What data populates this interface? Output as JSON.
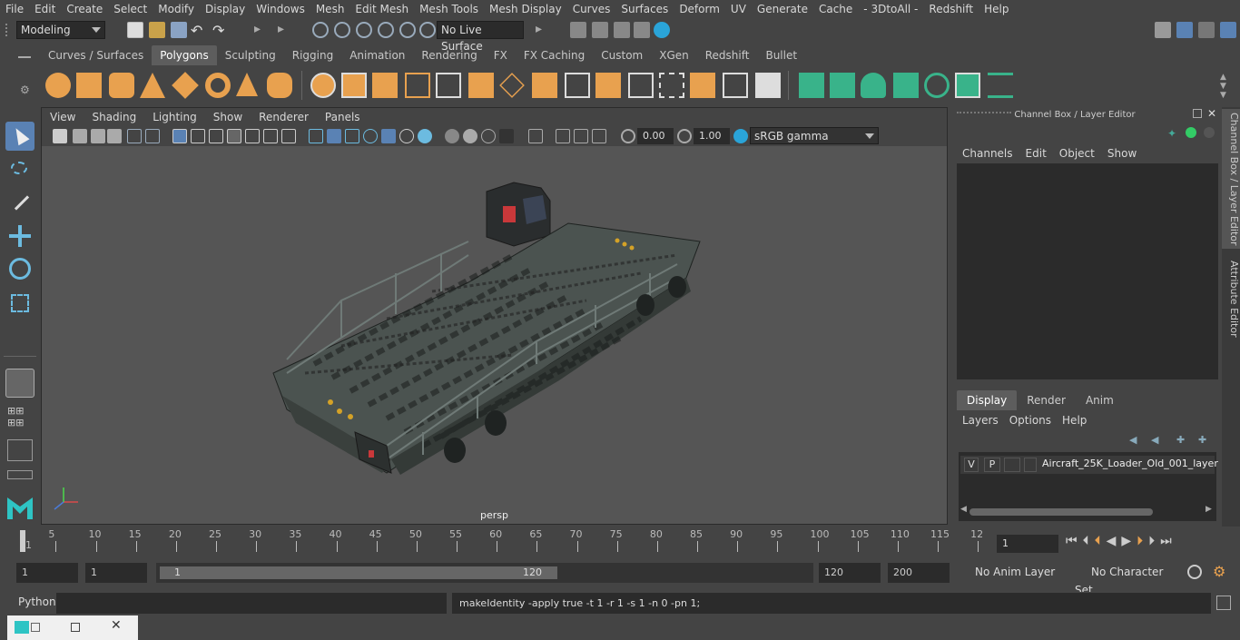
{
  "menubar": {
    "items": [
      "File",
      "Edit",
      "Create",
      "Select",
      "Modify",
      "Display",
      "Windows",
      "Mesh",
      "Edit Mesh",
      "Mesh Tools",
      "Mesh Display",
      "Curves",
      "Surfaces",
      "Deform",
      "UV",
      "Generate",
      "Cache",
      "- 3DtoAll -",
      "Redshift",
      "Help"
    ]
  },
  "statusline": {
    "mode": "Modeling",
    "live_surface": "No Live Surface"
  },
  "shelf": {
    "tabs": [
      "Curves / Surfaces",
      "Polygons",
      "Sculpting",
      "Rigging",
      "Animation",
      "Rendering",
      "FX",
      "FX Caching",
      "Custom",
      "XGen",
      "Redshift",
      "Bullet"
    ],
    "active_tab": "Polygons"
  },
  "viewport": {
    "menu": [
      "View",
      "Shading",
      "Lighting",
      "Show",
      "Renderer",
      "Panels"
    ],
    "exposure": "0.00",
    "gamma": "1.00",
    "color_space": "sRGB gamma",
    "camera_label": "persp"
  },
  "channelbox": {
    "title": "Channel Box / Layer Editor",
    "menu": [
      "Channels",
      "Edit",
      "Object",
      "Show"
    ],
    "layer_tabs": [
      "Display",
      "Render",
      "Anim"
    ],
    "active_layer_tab": "Display",
    "layer_menu": [
      "Layers",
      "Options",
      "Help"
    ],
    "layer": {
      "v": "V",
      "p": "P",
      "name": "Aircraft_25K_Loader_Old_001_layer"
    }
  },
  "sidetabs": {
    "channel_box": "Channel Box / Layer Editor",
    "attribute_editor": "Attribute Editor"
  },
  "timeslider": {
    "ticks": [
      "1",
      "5",
      "10",
      "15",
      "20",
      "25",
      "30",
      "35",
      "40",
      "45",
      "50",
      "55",
      "60",
      "65",
      "70",
      "75",
      "80",
      "85",
      "90",
      "95",
      "100",
      "105",
      "110",
      "115",
      "12"
    ],
    "current_frame": "1"
  },
  "range": {
    "start": "1",
    "start2": "1",
    "slider_start": "1",
    "slider_end": "120",
    "end": "120",
    "end2": "200",
    "anim_layer": "No Anim Layer",
    "char_set": "No Character Set"
  },
  "command": {
    "language": "Python",
    "result": "makeIdentity -apply true -t 1 -r 1 -s 1 -n 0 -pn 1;"
  },
  "colors": {
    "shelf_orange": "#e8a14f",
    "shelf_green": "#39b38a",
    "selection_blue": "#5a82b4"
  }
}
